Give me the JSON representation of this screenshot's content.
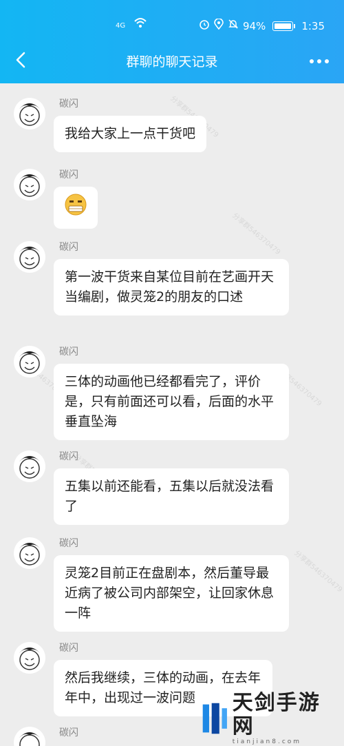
{
  "status_bar": {
    "network": "4G",
    "battery": "94%",
    "time": "1:35"
  },
  "header": {
    "title": "群聊的聊天记录"
  },
  "watermark": "分享群546370479",
  "messages": [
    {
      "sender": "碳闪",
      "text": "我给大家上一点干货吧"
    },
    {
      "sender": "碳闪",
      "text": "",
      "emoji": "face-emoji-icon"
    },
    {
      "sender": "碳闪",
      "text": "第一波干货来自某位目前在艺画开天当编剧，做灵笼2的朋友的口述"
    },
    {
      "sender": "碳闪",
      "text": "三体的动画他已经都看完了，评价是，只有前面还可以看，后面的水平垂直坠海"
    },
    {
      "sender": "碳闪",
      "text": "五集以前还能看，五集以后就没法看了"
    },
    {
      "sender": "碳闪",
      "text": "灵笼2目前正在盘剧本，然后董导最近病了被公司内部架空，让回家休息一阵"
    },
    {
      "sender": "碳闪",
      "text": "然后我继续，三体的动画，在去年年中，出现过一波问题"
    },
    {
      "sender": "碳闪",
      "text": ""
    }
  ],
  "logo": {
    "name": "天剑手游网",
    "domain": "tianjian8.com"
  }
}
